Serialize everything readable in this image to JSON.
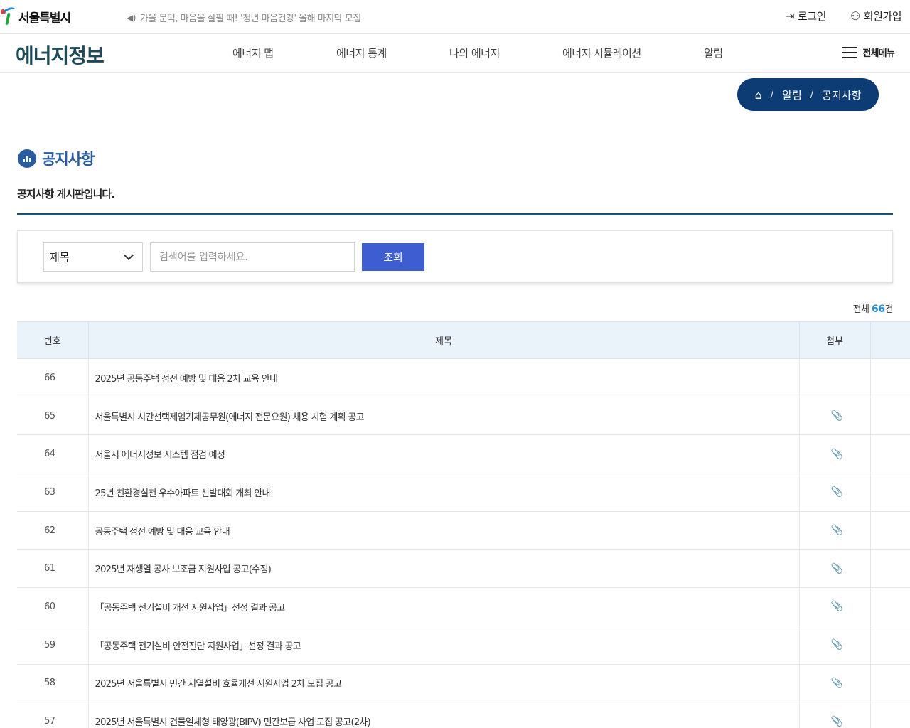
{
  "topbar": {
    "logo_text": "서울특별시",
    "ticker": "가을 문턱, 마음을 살필 때! '청년 마음건강' 올해 마지막 모집",
    "login": "로그인",
    "signup": "회원가입"
  },
  "nav": {
    "brand": "에너지정보",
    "items": [
      "에너지 맵",
      "에너지 통계",
      "나의 에너지",
      "에너지 시뮬레이션",
      "알림"
    ],
    "all_menu": "전체메뉴"
  },
  "breadcrumb": {
    "sep": "/",
    "level1": "알림",
    "level2": "공지사항"
  },
  "page": {
    "title": "공지사항",
    "desc": "공지사항 게시판입니다."
  },
  "search": {
    "select_value": "제목",
    "placeholder": "검색어를 입력하세요.",
    "button": "조회"
  },
  "total": {
    "prefix": "전체 ",
    "count": "66",
    "suffix": "건"
  },
  "table": {
    "headers": [
      "번호",
      "제목",
      "첨부"
    ],
    "rows": [
      {
        "num": "66",
        "title": "2025년 공동주택 정전 예방 및 대응 2차 교육 안내",
        "attach": ""
      },
      {
        "num": "65",
        "title": "서울특별시 시간선택제임기제공무원(에너지 전문요원) 채용 시험 계획 공고",
        "attach": "📎"
      },
      {
        "num": "64",
        "title": "서울시 에너지정보 시스템 점검 예정",
        "attach": "📎"
      },
      {
        "num": "63",
        "title": "25년 친환경실천 우수아파트 선발대회 개최 안내",
        "attach": "📎"
      },
      {
        "num": "62",
        "title": "공동주택 정전 예방 및 대응 교육 안내",
        "attach": "📎"
      },
      {
        "num": "61",
        "title": "2025년 재생열 공사 보조금 지원사업 공고(수정)",
        "attach": "📎"
      },
      {
        "num": "60",
        "title": "「공동주택 전기설비 개선 지원사업」선정 결과 공고",
        "attach": "📎"
      },
      {
        "num": "59",
        "title": "「공동주택 전기설비 안전진단 지원사업」선정 결과 공고",
        "attach": "📎"
      },
      {
        "num": "58",
        "title": "2025년 서울특별시 민간 지열설비 효율개선 지원사업 2차 모집 공고",
        "attach": "📎"
      },
      {
        "num": "57",
        "title": "2025년 서울특별시 건물일체형 태양광(BIPV) 민간보급 사업 모집 공고(2차)",
        "attach": "📎"
      }
    ]
  }
}
